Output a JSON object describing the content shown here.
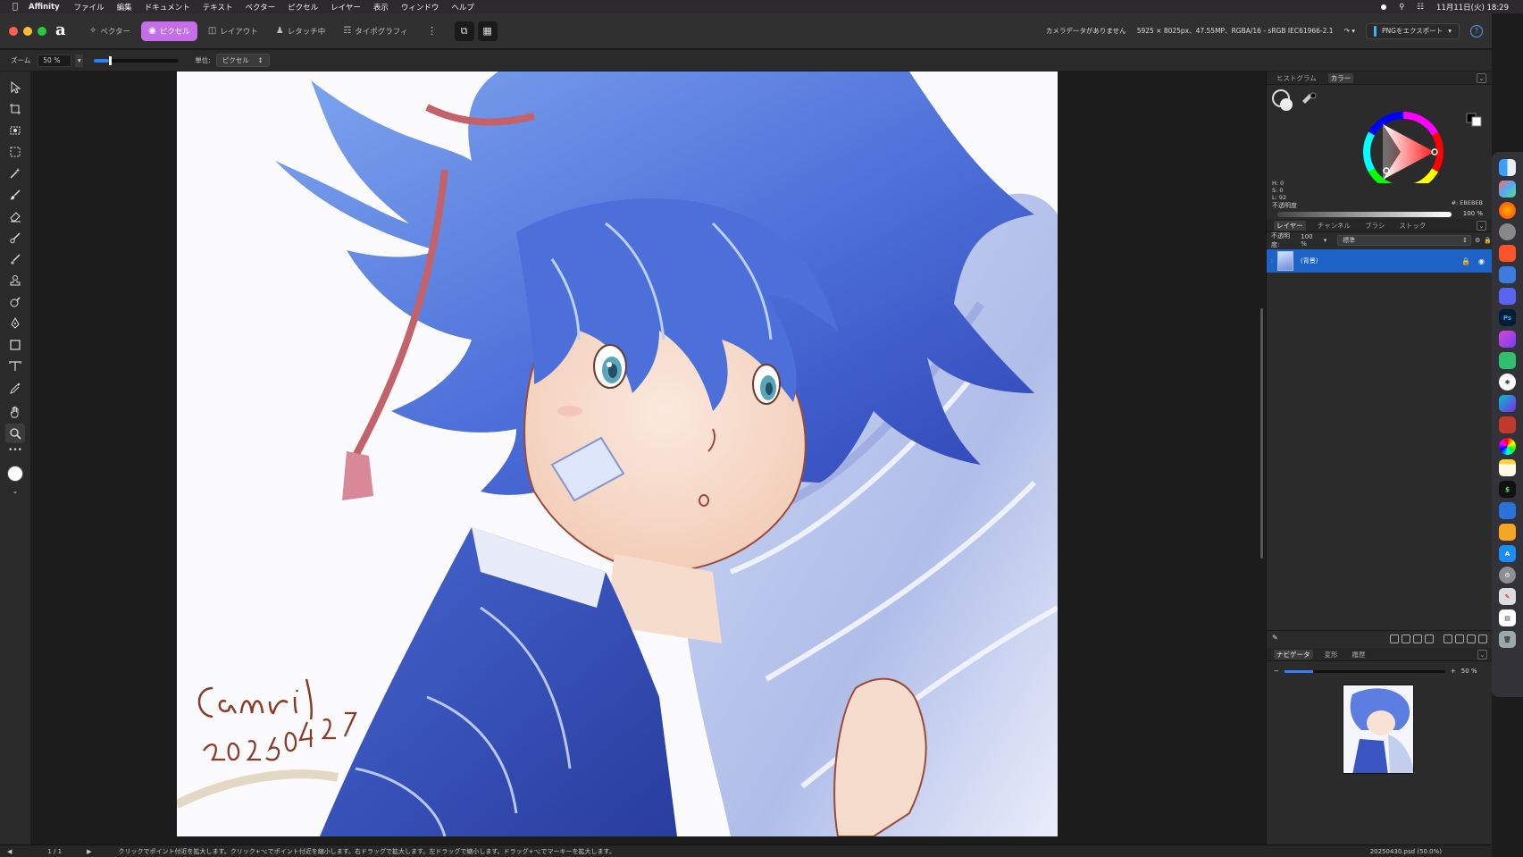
{
  "menubar": {
    "app": "Affinity",
    "items": [
      "ファイル",
      "編集",
      "ドキュメント",
      "テキスト",
      "ベクター",
      "ピクセル",
      "レイヤー",
      "表示",
      "ウィンドウ",
      "ヘルプ"
    ],
    "datetime": "11月11日(火) 18:29"
  },
  "toolbar": {
    "personas": [
      {
        "label": "ベクター",
        "icon": "vector-icon",
        "active": false
      },
      {
        "label": "ピクセル",
        "icon": "pixel-icon",
        "active": true
      },
      {
        "label": "レイアウト",
        "icon": "layout-icon",
        "active": false
      },
      {
        "label": "レタッチ中",
        "icon": "retouch-icon",
        "active": false
      },
      {
        "label": "タイポグラフィ",
        "icon": "typography-icon",
        "active": false
      }
    ],
    "camera_info": "カメラデータがありません",
    "doc_info": "5925 × 8025px、47.55MP、RGBA/16 - sRGB IEC61966-2.1",
    "export_label": "PNGをエクスポート",
    "help": "?"
  },
  "context": {
    "zoom_label": "ズーム",
    "zoom_value": "50 %",
    "zoom_fraction": 0.18,
    "unit_label": "単位:",
    "unit_value": "ピクセル"
  },
  "color_panel": {
    "tabs": [
      {
        "label": "ヒストグラム",
        "active": false
      },
      {
        "label": "カラー",
        "active": true
      }
    ],
    "h": "H: 0",
    "s": "S: 0",
    "l": "L: 92",
    "hex": "#: EBEBEB",
    "opacity_label": "不透明度",
    "opacity_value": "100 %"
  },
  "layers_panel": {
    "tabs": [
      {
        "label": "レイヤー",
        "active": true
      },
      {
        "label": "チャンネル",
        "active": false
      },
      {
        "label": "ブラシ",
        "active": false
      },
      {
        "label": "ストック",
        "active": false
      }
    ],
    "opacity_label": "不透明度:",
    "opacity_value": "100 %",
    "blend_mode": "標準",
    "layers": [
      {
        "name": "(背景)",
        "selected": true
      }
    ]
  },
  "navigator": {
    "tabs": [
      {
        "label": "ナビゲータ",
        "active": true
      },
      {
        "label": "変形",
        "active": false
      },
      {
        "label": "履歴",
        "active": false
      }
    ],
    "zoom_value": "50 %"
  },
  "status": {
    "page": "1 / 1",
    "hint": "クリックでポイント付近を拡大します。クリック+⌥でポイント付近を縮小します。右ドラッグで拡大します。左ドラッグで縮小します。ドラッグ+⌥でマーキーを拡大します。",
    "file": "20250430.psd (50.0%)"
  },
  "artwork": {
    "signature": "Camri",
    "date": "2025.04.27"
  },
  "colors": {
    "accent": "#c46ee8",
    "selection": "#1d62c7",
    "export_accent": "#3db0ff"
  },
  "dock_icons": [
    "finder-icon",
    "launchpad-icon",
    "firefox-icon",
    "chrome-icon",
    "brave-icon",
    "app-icon",
    "discord-icon",
    "photoshop-icon",
    "affinity-photo-icon",
    "affinity-icon",
    "chatgpt-icon",
    "canva-icon",
    "photo-booth-icon",
    "photos-icon",
    "notes-icon",
    "terminal-icon",
    "app-switch-icon",
    "home-icon",
    "app-store-icon",
    "settings-icon",
    "pen-icon",
    "document-icon",
    "trash-icon"
  ]
}
